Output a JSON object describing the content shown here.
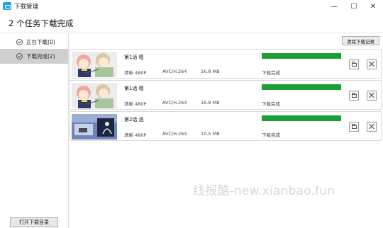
{
  "window": {
    "title": "下载管理",
    "icon": "app-tv-icon",
    "controls": [
      "minimize-icon",
      "maximize-icon",
      "close-icon"
    ],
    "minimize_glyph": "—",
    "maximize_glyph": "☐",
    "close_glyph": "✕"
  },
  "header": {
    "title": "2 个任务下载完成"
  },
  "sidebar": {
    "items": [
      {
        "label": "正在下载(0)",
        "icon": "check-circle-icon",
        "active": false
      },
      {
        "label": "下载完成(2)",
        "icon": "check-circle-icon",
        "active": true
      }
    ],
    "open_dir_label": "打开下载目录"
  },
  "toolbar": {
    "clear_label": "清除下载记录"
  },
  "tasks": [
    {
      "title": "第1话 嗯",
      "quality": "清晰 480P",
      "codec": "AVC/H.264",
      "size": "16.8 MB",
      "progress": 1.0,
      "status": "下载完成",
      "thumb": "anime-girls-thumbnail"
    },
    {
      "title": "第1话 嗯",
      "quality": "清晰 480P",
      "codec": "AVC/H.264",
      "size": "16.8 MB",
      "progress": 1.0,
      "status": "下载完成",
      "thumb": "anime-girls-thumbnail"
    },
    {
      "title": "第2话 逃",
      "quality": "清晰 480P",
      "codec": "AVC/H.264",
      "size": "10.5 MB",
      "progress": 1.0,
      "status": "下载完成",
      "thumb": "anime-cat-thumbnail"
    }
  ],
  "watermark": "线报酷-new.xianbao.fun",
  "colors": {
    "progress": "#1aa036",
    "accent": "#1ca7e0",
    "active_item": "#cfcfcf"
  }
}
